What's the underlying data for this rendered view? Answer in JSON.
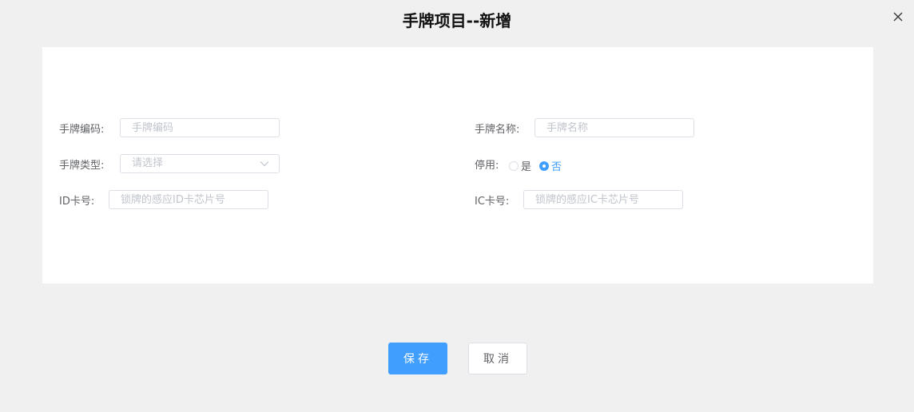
{
  "dialog": {
    "title": "手牌项目--新增"
  },
  "form": {
    "code": {
      "label": "手牌编码:",
      "placeholder": "手牌编码",
      "value": ""
    },
    "name": {
      "label": "手牌名称:",
      "placeholder": "手牌名称",
      "value": ""
    },
    "type": {
      "label": "手牌类型:",
      "placeholder": "请选择"
    },
    "disabled": {
      "label": "停用:",
      "options": [
        "是",
        "否"
      ],
      "selected": "否"
    },
    "id_card": {
      "label": "ID卡号:",
      "placeholder": "锁牌的感应ID卡芯片号",
      "value": ""
    },
    "ic_card": {
      "label": "IC卡号:",
      "placeholder": "锁牌的感应IC卡芯片号",
      "value": ""
    }
  },
  "actions": {
    "save_label": "保存",
    "cancel_label": "取消"
  },
  "colors": {
    "primary": "#409eff",
    "background": "#f0f0f0",
    "panel": "#ffffff"
  },
  "icons": {
    "close": "close-icon",
    "select_arrow": "chevron-down-icon"
  }
}
